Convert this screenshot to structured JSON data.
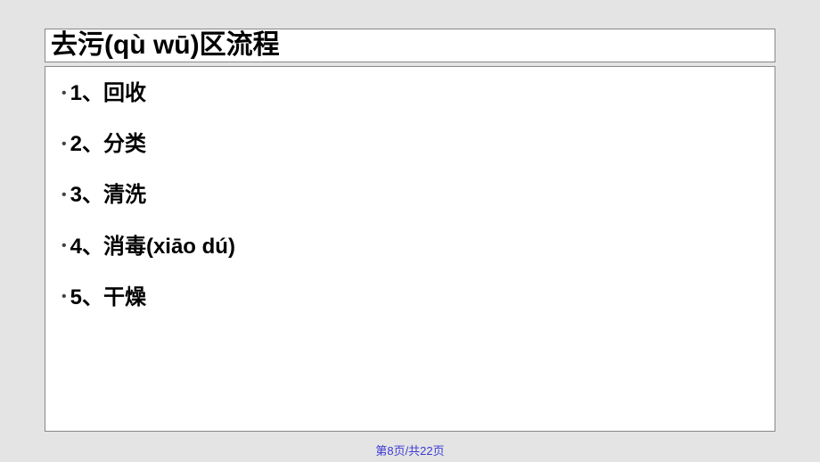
{
  "title": "去污(qù wū)区流程",
  "items": [
    "1、回收",
    "2、分类",
    "3、清洗",
    "4、消毒(xiāo dú)",
    "5、干燥"
  ],
  "page_indicator": "第8页/共22页"
}
